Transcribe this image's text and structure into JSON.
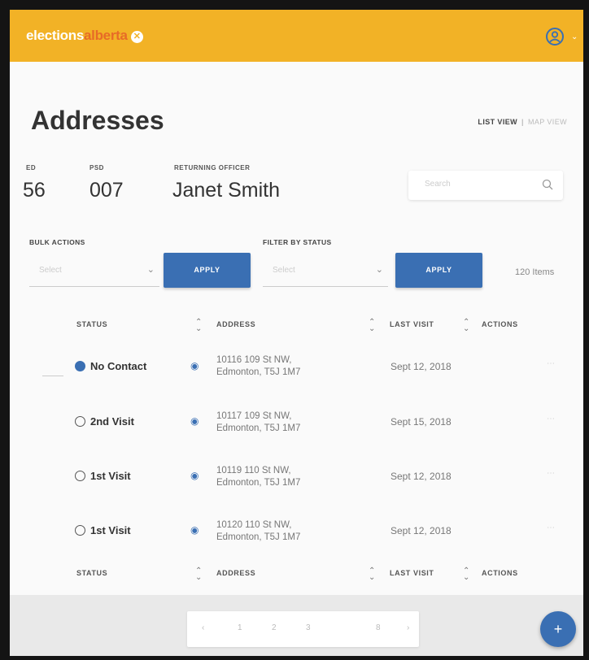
{
  "brand": {
    "part1": "elections",
    "part2": "alberta",
    "badge": "✕"
  },
  "header": {
    "user_icon": "user-circle-icon",
    "caret": "⌄"
  },
  "page": {
    "title": "Addresses"
  },
  "view_toggle": {
    "list": "LIST VIEW",
    "separator": "|",
    "map": "MAP VIEW"
  },
  "meta": {
    "ed_label": "ED",
    "ed_value": "56",
    "psd_label": "PSD",
    "psd_value": "007",
    "ro_label": "RETURNING OFFICER",
    "ro_value": "Janet Smith"
  },
  "search": {
    "placeholder": "Search",
    "icon": "search-icon"
  },
  "bulk": {
    "label": "BULK ACTIONS",
    "placeholder": "Select",
    "button": "APPLY"
  },
  "filter": {
    "label": "FILTER BY STATUS",
    "placeholder": "Select",
    "button": "APPLY"
  },
  "item_count": "120 Items",
  "table": {
    "headers": {
      "status": "STATUS",
      "address": "ADDRESS",
      "last_visit": "LAST VISIT",
      "actions": "ACTIONS"
    },
    "rows": [
      {
        "status": "No Contact",
        "filled": true,
        "addr1": "10116 109 St NW,",
        "addr2": "Edmonton, T5J 1M7",
        "date": "Sept 12, 2018"
      },
      {
        "status": "2nd Visit",
        "filled": false,
        "addr1": "10117 109 St NW,",
        "addr2": "Edmonton, T5J 1M7",
        "date": "Sept 15, 2018"
      },
      {
        "status": "1st Visit",
        "filled": false,
        "addr1": "10119 110 St NW,",
        "addr2": "Edmonton, T5J 1M7",
        "date": "Sept 12, 2018"
      },
      {
        "status": "1st Visit",
        "filled": false,
        "addr1": "10120 110 St NW,",
        "addr2": "Edmonton, T5J 1M7",
        "date": "Sept 12, 2018"
      }
    ]
  },
  "pagination": {
    "prev": "‹",
    "p1": "1",
    "p2": "2",
    "p3": "3",
    "last": "8",
    "next": "›"
  },
  "fab": {
    "label": "+"
  },
  "colors": {
    "brand": "#f2b226",
    "accent": "#3a6fb3"
  }
}
